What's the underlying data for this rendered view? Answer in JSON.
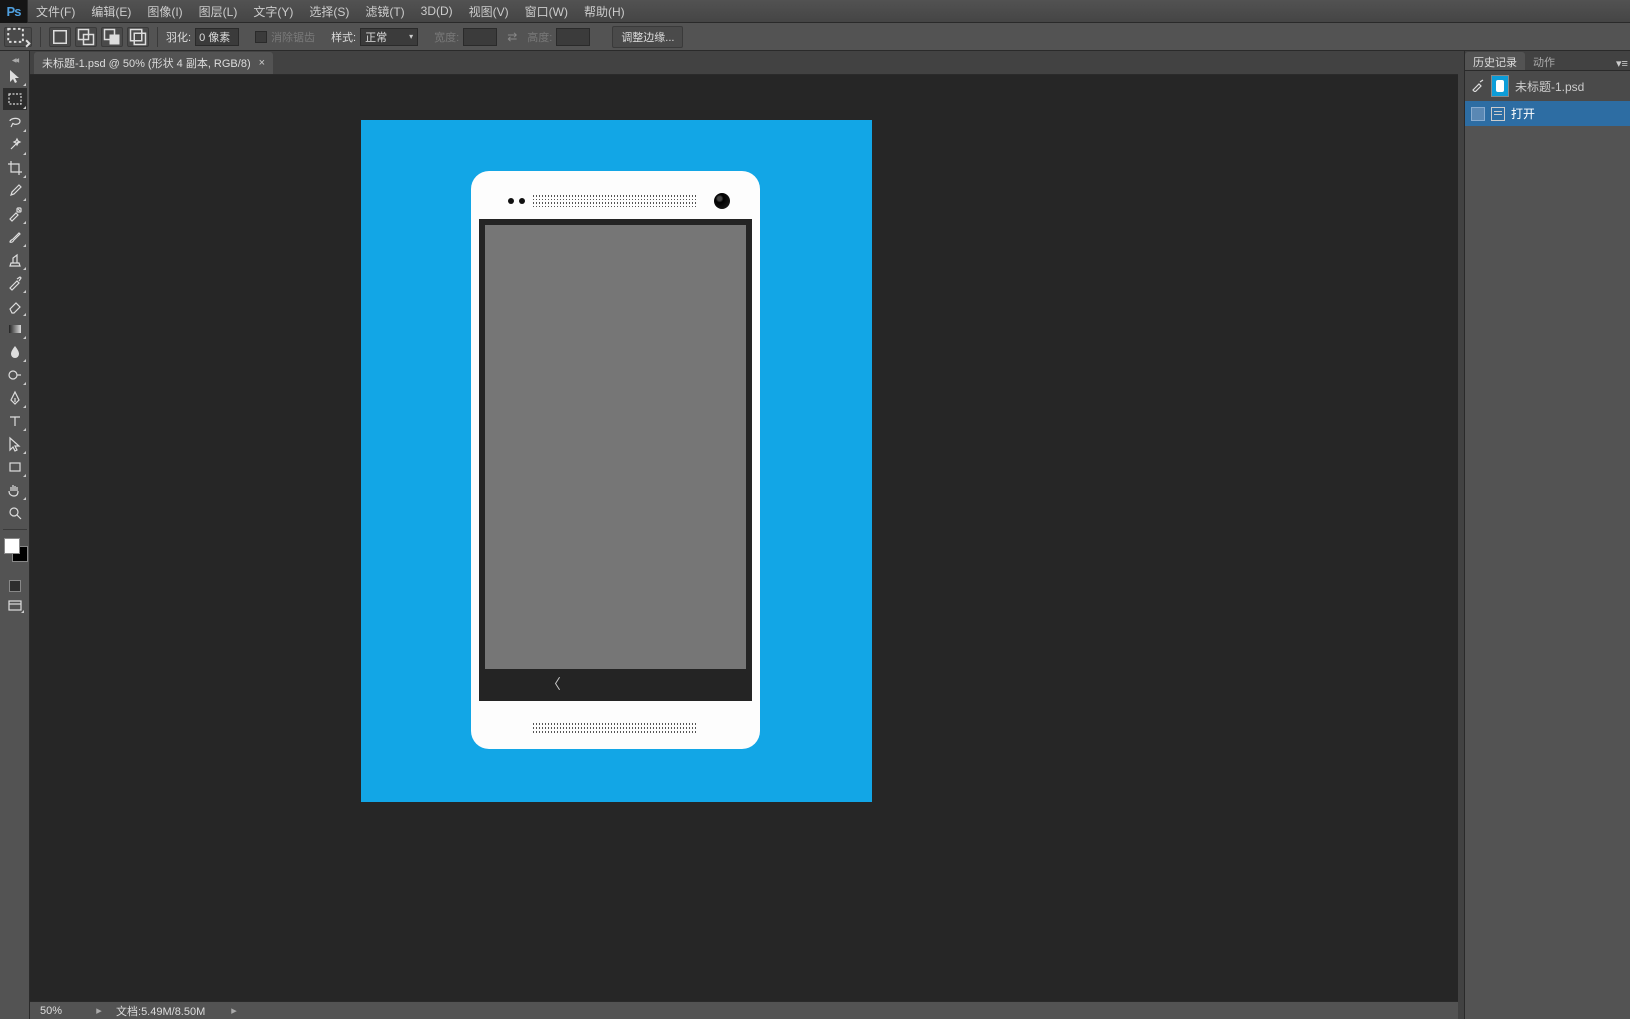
{
  "app": {
    "logo": "Ps"
  },
  "menu": {
    "items": [
      "文件(F)",
      "编辑(E)",
      "图像(I)",
      "图层(L)",
      "文字(Y)",
      "选择(S)",
      "滤镜(T)",
      "3D(D)",
      "视图(V)",
      "窗口(W)",
      "帮助(H)"
    ]
  },
  "options": {
    "feather_label": "羽化:",
    "feather_value": "0 像素",
    "antialias_label": "消除锯齿",
    "style_label": "样式:",
    "style_value": "正常",
    "width_label": "宽度:",
    "height_label": "高度:",
    "refine_label": "调整边缘..."
  },
  "doc_tab": {
    "title": "未标题-1.psd @ 50% (形状 4 副本, RGB/8)"
  },
  "status": {
    "zoom": "50%",
    "docinfo_label": "文档:",
    "docinfo_value": "5.49M/8.50M"
  },
  "right_panel": {
    "tabs": [
      "历史记录",
      "动作"
    ],
    "history_doc": "未标题-1.psd",
    "history_step": "打开"
  }
}
